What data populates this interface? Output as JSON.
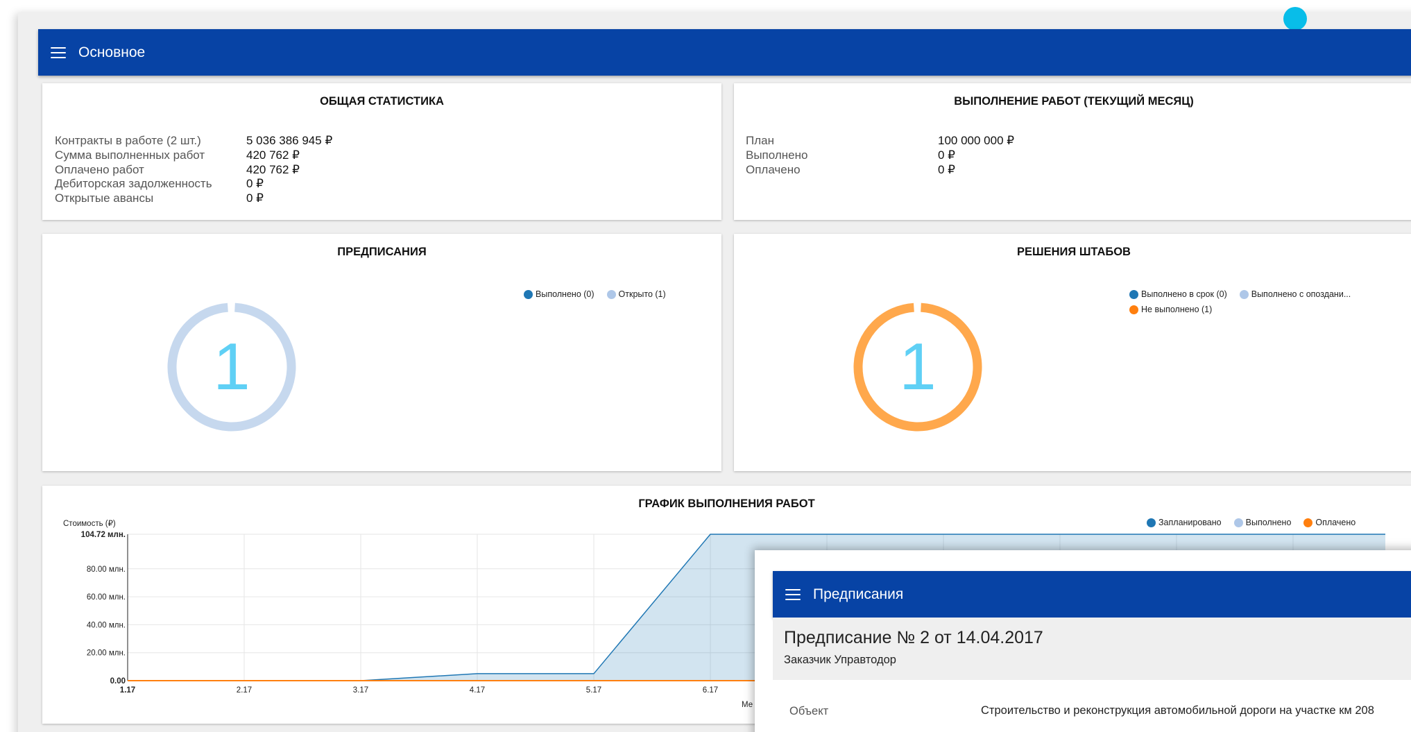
{
  "appbar": {
    "title": "Основное"
  },
  "general_stats": {
    "title": "ОБЩАЯ СТАТИСТИКА",
    "rows": [
      {
        "label": "Контракты в работе (2 шт.)",
        "value": "5 036 386 945 ₽"
      },
      {
        "label": "Сумма выполненных работ",
        "value": "420 762 ₽"
      },
      {
        "label": "Оплачено работ",
        "value": "420 762 ₽"
      },
      {
        "label": "Дебиторская задолженность",
        "value": "0 ₽"
      },
      {
        "label": "Открытые авансы",
        "value": "0 ₽"
      }
    ]
  },
  "monthly": {
    "title": "ВЫПОЛНЕНИЕ РАБОТ (ТЕКУЩИЙ МЕСЯЦ)",
    "rows": [
      {
        "label": "План",
        "value": "100 000 000 ₽"
      },
      {
        "label": "Выполнено",
        "value": "0 ₽"
      },
      {
        "label": "Оплачено",
        "value": "0 ₽"
      }
    ]
  },
  "prescriptions": {
    "title": "ПРЕДПИСАНИЯ",
    "total": "1",
    "legend": [
      {
        "label": "Выполнено (0)",
        "color": "#1f77b4"
      },
      {
        "label": "Открыто (1)",
        "color": "#aec7e8"
      }
    ],
    "ring_color": "#c6d8ee",
    "number_color": "#5fd0f5"
  },
  "hq_decisions": {
    "title": "РЕШЕНИЯ ШТАБОВ",
    "total": "1",
    "legend": [
      {
        "label": "Выполнено в срок (0)",
        "color": "#1f77b4"
      },
      {
        "label": "Выполнено с опоздани...",
        "color": "#aec7e8"
      },
      {
        "label": "Не выполнено (1)",
        "color": "#ff7f0e"
      }
    ],
    "ring_color": "#ffa84c",
    "number_color": "#5fd0f5"
  },
  "chart_data": {
    "type": "area",
    "title": "ГРАФИК ВЫПОЛНЕНИЯ РАБОТ",
    "ylabel": "Стоимость (₽)",
    "xlabel": "Ме",
    "x": [
      "1.17",
      "2.17",
      "3.17",
      "4.17",
      "5.17",
      "6.17"
    ],
    "y_ticks": [
      "0.00",
      "20.00 млн.",
      "40.00 млн.",
      "60.00 млн.",
      "80.00 млн.",
      "104.72 млн."
    ],
    "y_tick_values": [
      0,
      20,
      40,
      60,
      80,
      104.72
    ],
    "ylim": [
      0,
      104.72
    ],
    "series": [
      {
        "name": "Запланировано",
        "color": "#1f77b4",
        "points": [
          [
            1,
            0
          ],
          [
            2,
            0
          ],
          [
            3,
            0
          ],
          [
            4,
            5
          ],
          [
            5,
            5
          ],
          [
            6,
            104.72
          ],
          [
            11.8,
            104.72
          ]
        ]
      },
      {
        "name": "Выполнено",
        "color": "#aec7e8",
        "points": [
          [
            1,
            0
          ],
          [
            11.8,
            0
          ]
        ]
      },
      {
        "name": "Оплачено",
        "color": "#ff7f0e",
        "points": [
          [
            1,
            0
          ],
          [
            11.8,
            0
          ]
        ]
      }
    ],
    "grid": true,
    "legend_position": "top-right"
  },
  "overlay": {
    "title": "Предписания",
    "heading": "Предписание № 2 от 14.04.2017",
    "subheading": "Заказчик Управтодор",
    "field_label": "Объект",
    "field_value": "Строительство и реконструкция автомобильной дороги на участке км 208"
  }
}
